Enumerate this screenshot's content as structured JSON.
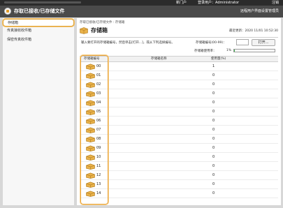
{
  "topbar": {
    "menu_label": "新门户",
    "user_label": "登录用户：Administrator",
    "logout_label": "注销"
  },
  "header": {
    "title": "存取已接收/已存储文件",
    "login_info": "远程用户界面设置管理员"
  },
  "sidebar": {
    "items": [
      {
        "label": "存储箱"
      },
      {
        "label": "传真接收收件箱"
      },
      {
        "label": "保密传真收件箱"
      }
    ]
  },
  "main": {
    "breadcrumb": "存取已接收/已存储文件 : 存储箱",
    "title": "存储箱",
    "last_update": "最近更新：2020 11/01 10:52:30",
    "instruction": "输入要打开的存储箱编号，然后单击[打开...]，或从下列选择编号。",
    "box_number_label": "存储箱编号(00-99)：",
    "box_number_value": "",
    "open_button": "打开...",
    "usage_label": "存储箱使用率：",
    "usage_value": "1%",
    "usage_percent": 1,
    "columns": [
      "存储箱编号",
      "存储箱名称",
      "使用量(%)"
    ],
    "rows": [
      {
        "number": "00",
        "name": "",
        "used": "1"
      },
      {
        "number": "01",
        "name": "",
        "used": "0"
      },
      {
        "number": "02",
        "name": "",
        "used": "0"
      },
      {
        "number": "03",
        "name": "",
        "used": "0"
      },
      {
        "number": "04",
        "name": "",
        "used": "0"
      },
      {
        "number": "05",
        "name": "",
        "used": "0"
      },
      {
        "number": "06",
        "name": "",
        "used": "0"
      },
      {
        "number": "07",
        "name": "",
        "used": "0"
      },
      {
        "number": "08",
        "name": "",
        "used": "0"
      },
      {
        "number": "09",
        "name": "",
        "used": "0"
      },
      {
        "number": "10",
        "name": "",
        "used": "0"
      },
      {
        "number": "11",
        "name": "",
        "used": "0"
      },
      {
        "number": "12",
        "name": "",
        "used": "0"
      },
      {
        "number": "13",
        "name": "",
        "used": "0"
      },
      {
        "number": "14",
        "name": "",
        "used": "0"
      }
    ]
  },
  "colors": {
    "highlight": "#e9a43b",
    "usage_bar": "#3ab34a",
    "header_bg": "#4a4a4a"
  },
  "icons": {
    "box": "storage-box-icon",
    "app": "app-logo-icon"
  }
}
